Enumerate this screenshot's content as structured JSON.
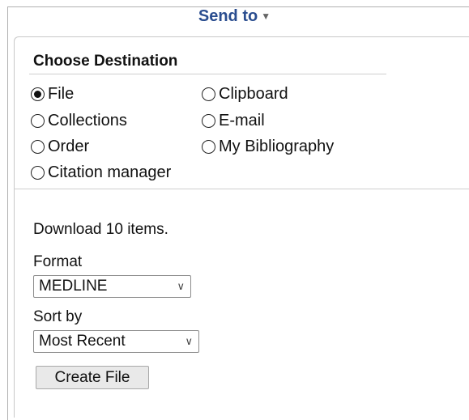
{
  "header": {
    "send_to": "Send to"
  },
  "destination": {
    "title": "Choose Destination",
    "options": [
      {
        "label": "File",
        "selected": true
      },
      {
        "label": "Clipboard",
        "selected": false
      },
      {
        "label": "Collections",
        "selected": false
      },
      {
        "label": "E-mail",
        "selected": false
      },
      {
        "label": "Order",
        "selected": false
      },
      {
        "label": "My Bibliography",
        "selected": false
      },
      {
        "label": "Citation manager",
        "selected": false
      }
    ]
  },
  "file": {
    "download_text": "Download 10 items.",
    "format_label": "Format",
    "format_value": "MEDLINE",
    "sort_label": "Sort by",
    "sort_value": "Most Recent",
    "create_button": "Create File"
  }
}
